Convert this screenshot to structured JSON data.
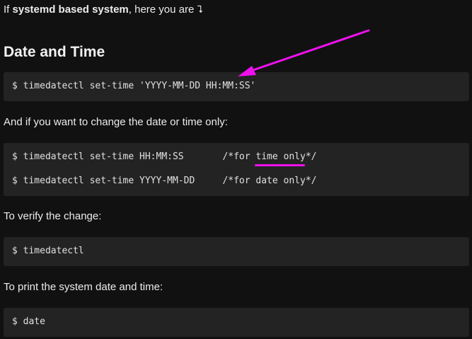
{
  "intro": {
    "prefix": "If ",
    "bold": "systemd based system",
    "suffix": ", here you are ",
    "arrow_glyph": "⮧"
  },
  "heading": "Date and Time",
  "code_blocks": [
    {
      "lines": [
        "$ timedatectl set-time 'YYYY-MM-DD HH:MM:SS'"
      ]
    },
    {
      "lines": [
        "$ timedatectl set-time HH:MM:SS       /*for time only*/",
        "$ timedatectl set-time YYYY-MM-DD     /*for date only*/"
      ]
    },
    {
      "lines": [
        "$ timedatectl"
      ]
    },
    {
      "lines": [
        "$ date"
      ]
    }
  ],
  "paragraphs": {
    "change_only": "And if you want to change the date or time only:",
    "verify": "To verify the change:",
    "print": "To print the system date and time:"
  },
  "annotations": {
    "color": "#ee11ee",
    "arrow": "magenta-arrow",
    "underline": "magenta-underline"
  }
}
